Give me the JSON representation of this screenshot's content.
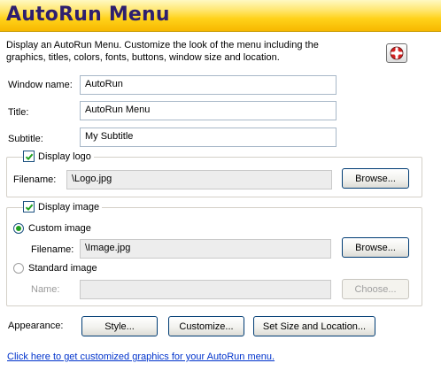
{
  "banner": {
    "title": "AutoRun Menu"
  },
  "description": "Display an AutoRun Menu. Customize the look of the menu including the graphics, titles, colors, fonts, buttons, window size and location.",
  "help_icon": {
    "icon": "help-icon",
    "colors": {
      "red": "#d42020",
      "white": "#ffffff"
    }
  },
  "fields": {
    "window_name": {
      "label": "Window name:",
      "value": "AutoRun"
    },
    "title": {
      "label": "Title:",
      "value": "AutoRun Menu"
    },
    "subtitle": {
      "label": "Subtitle:",
      "value": "My Subtitle"
    }
  },
  "logo_group": {
    "checkbox_label": "Display logo",
    "checked": true,
    "filename_label": "Filename:",
    "filename_value": "\\Logo.jpg",
    "browse_label": "Browse..."
  },
  "image_group": {
    "checkbox_label": "Display image",
    "checked": true,
    "custom": {
      "label": "Custom image",
      "selected": true,
      "filename_label": "Filename:",
      "filename_value": "\\Image.jpg",
      "browse_label": "Browse..."
    },
    "standard": {
      "label": "Standard image",
      "selected": false,
      "name_label": "Name:",
      "name_value": "",
      "choose_label": "Choose..."
    }
  },
  "appearance": {
    "label": "Appearance:",
    "style_label": "Style...",
    "customize_label": "Customize...",
    "size_location_label": "Set Size and Location..."
  },
  "link_text": "Click here to get customized graphics for your AutoRun menu.",
  "colors": {
    "banner_title": "#2e1f6e",
    "banner_gradient": [
      "#fff9c2",
      "#ffd21a",
      "#f7b800"
    ],
    "link": "#0033cc",
    "check_mark": "#21a121"
  }
}
